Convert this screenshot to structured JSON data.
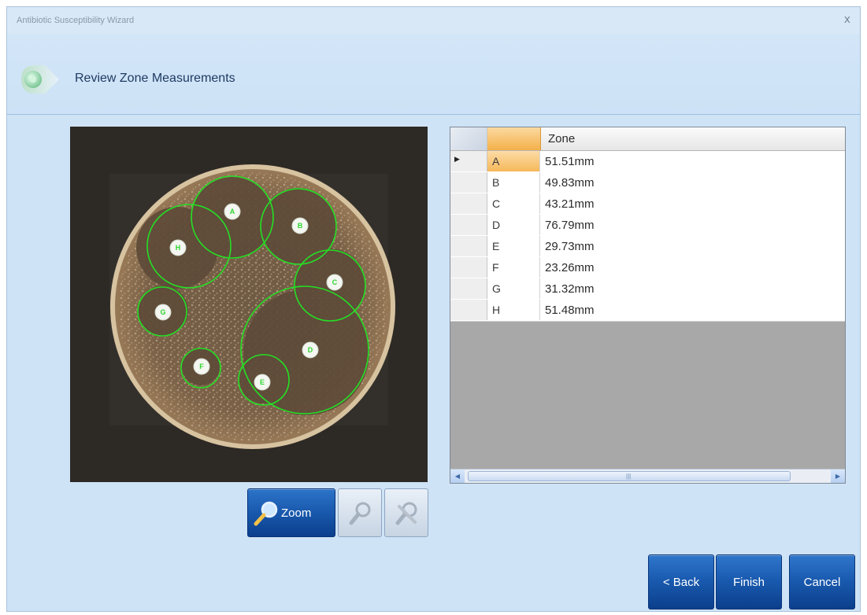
{
  "window": {
    "title": "Antibiotic Susceptibility Wizard",
    "close_glyph": "x"
  },
  "header": {
    "title": "Review Zone Measurements",
    "icon": "step-arrow-icon"
  },
  "plate": {
    "zone_labels": [
      "A",
      "B",
      "C",
      "D",
      "E",
      "F",
      "G",
      "H"
    ]
  },
  "tools": {
    "zoom_label": "Zoom",
    "zoom_icon": "magnifier-icon",
    "second_icon": "magnifier-disabled-icon",
    "third_icon": "cross-magnifier-disabled-icon"
  },
  "grid": {
    "columns": [
      "",
      "Zone"
    ],
    "rows": [
      {
        "name": "A",
        "zone": "51.51mm"
      },
      {
        "name": "B",
        "zone": "49.83mm"
      },
      {
        "name": "C",
        "zone": "43.21mm"
      },
      {
        "name": "D",
        "zone": "76.79mm"
      },
      {
        "name": "E",
        "zone": "29.73mm"
      },
      {
        "name": "F",
        "zone": "23.26mm"
      },
      {
        "name": "G",
        "zone": "31.32mm"
      },
      {
        "name": "H",
        "zone": "51.48mm"
      }
    ],
    "current_row_indicator": "▶",
    "scroll_left": "◀",
    "scroll_right": "▶",
    "scroll_grip": "|||"
  },
  "nav": {
    "back_label": "< Back",
    "finish_label": "Finish",
    "cancel_label": "Cancel"
  },
  "colors": {
    "zone_circle": "#24e024",
    "accent_blue": "#1a5bb0",
    "selection_orange": "#f6b85a"
  }
}
